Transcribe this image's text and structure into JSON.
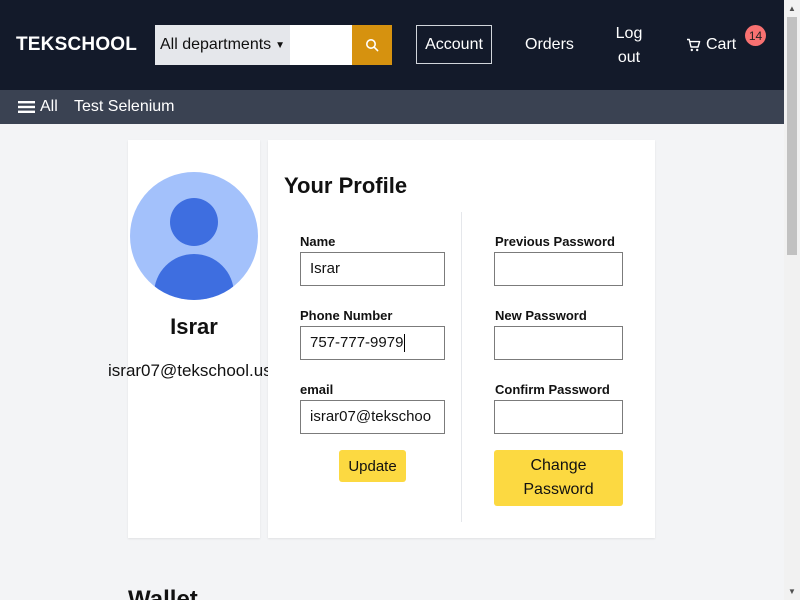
{
  "header": {
    "brand": "TEKSCHOOL",
    "department_select": "All departments",
    "search_value": "",
    "account": "Account",
    "orders": "Orders",
    "logout": "Log out",
    "cart": "Cart",
    "cart_count": "14"
  },
  "subnav": {
    "all": "All",
    "test_link": "Test Selenium"
  },
  "profile_sidebar": {
    "name": "Israr",
    "email": "israr07@tekschool.us"
  },
  "profile_form": {
    "title": "Your Profile",
    "name_label": "Name",
    "name_value": "Israr",
    "phone_label": "Phone Number",
    "phone_value": "757-777-9979",
    "email_label": "email",
    "email_value": "israr07@tekschoo",
    "update_button": "Update",
    "prev_password_label": "Previous Password",
    "new_password_label": "New Password",
    "confirm_password_label": "Confirm Password",
    "change_password_button": "Change Password"
  },
  "wallet": {
    "title": "Wallet"
  },
  "icons": {
    "search": "search-icon",
    "cart": "cart-icon",
    "menu": "hamburger-icon",
    "avatar": "user-avatar-icon"
  },
  "colors": {
    "header_bg": "#131a2a",
    "subnav_bg": "#3a4252",
    "search_button": "#d6920f",
    "primary_button": "#fcd941",
    "badge": "#f87171",
    "avatar_bg": "#a3c1fb",
    "avatar_fg": "#3e6ee0"
  }
}
